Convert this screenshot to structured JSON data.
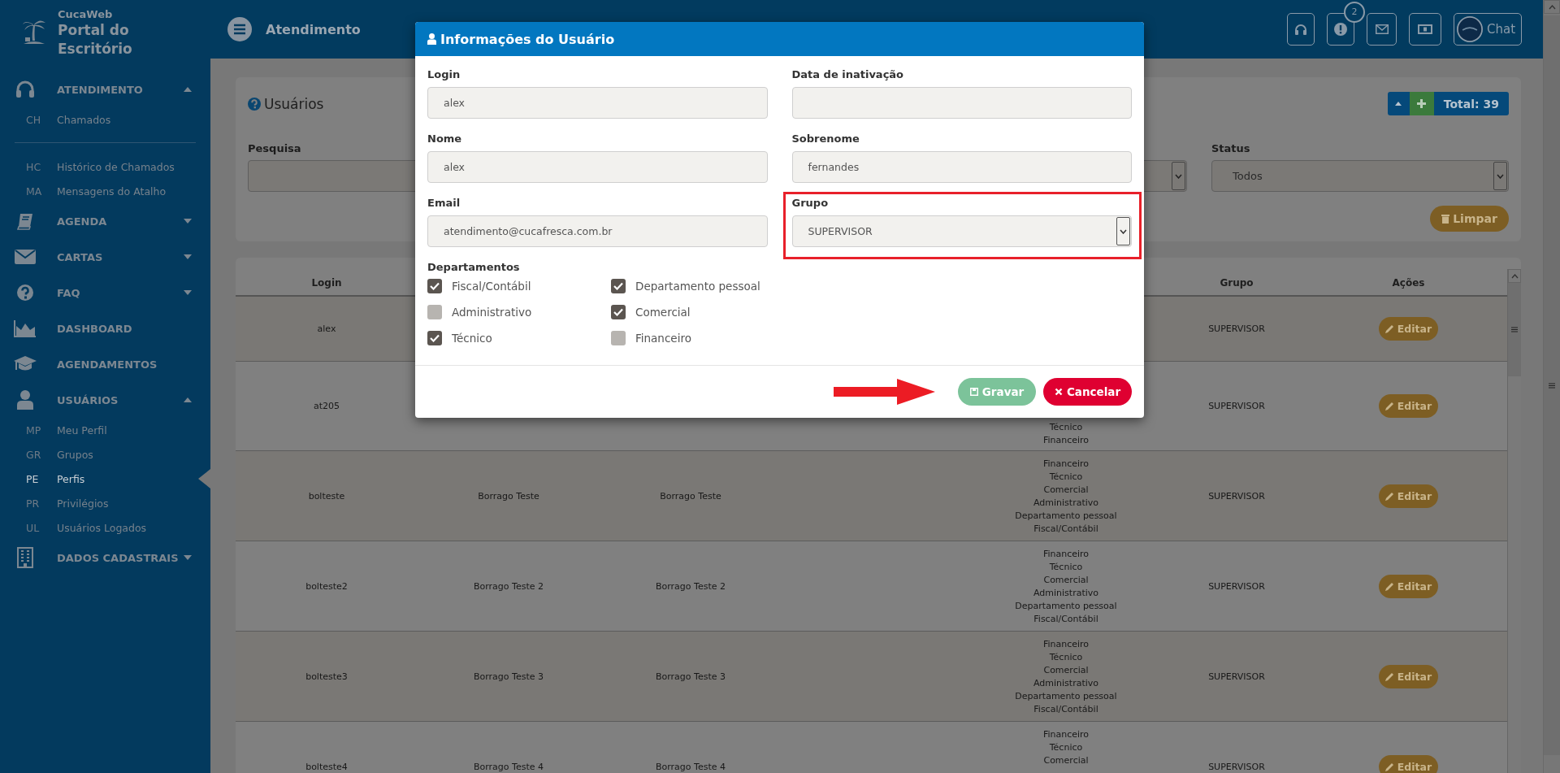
{
  "sidebar": {
    "app_name": "CucaWeb",
    "title": "Portal do Escritório",
    "sections": [
      {
        "label": "ATENDIMENTO",
        "kind": "group",
        "expanded": true,
        "children": [
          {
            "code": "CH",
            "label": "Chamados",
            "selected": false,
            "divider_above": false
          },
          {
            "code": "HC",
            "label": "Histórico de Chamados",
            "selected": false,
            "divider_above": true
          },
          {
            "code": "MA",
            "label": "Mensagens do Atalho",
            "selected": false,
            "divider_above": false
          }
        ]
      },
      {
        "label": "AGENDA",
        "kind": "group",
        "expanded": false
      },
      {
        "label": "CARTAS",
        "kind": "group",
        "expanded": false
      },
      {
        "label": "FAQ",
        "kind": "group",
        "expanded": false
      },
      {
        "label": "DASHBOARD",
        "kind": "link"
      },
      {
        "label": "AGENDAMENTOS",
        "kind": "link"
      },
      {
        "label": "USUÁRIOS",
        "kind": "group",
        "expanded": true,
        "children": [
          {
            "code": "MP",
            "label": "Meu Perfil",
            "selected": false,
            "divider_above": false
          },
          {
            "code": "GR",
            "label": "Grupos",
            "selected": false,
            "divider_above": false
          },
          {
            "code": "PE",
            "label": "Perfis",
            "selected": true,
            "divider_above": false
          },
          {
            "code": "PR",
            "label": "Privilégios",
            "selected": false,
            "divider_above": false
          },
          {
            "code": "UL",
            "label": "Usuários Logados",
            "selected": false,
            "divider_above": false
          }
        ]
      },
      {
        "label": "DADOS CADASTRAIS",
        "kind": "group",
        "expanded": false
      }
    ]
  },
  "header": {
    "title": "Atendimento",
    "notification_count": "2",
    "chat_label": "Chat"
  },
  "page": {
    "title": "Usuários",
    "total": "Total: 39",
    "filters": [
      {
        "label": "Pesquisa",
        "kind": "text"
      },
      {
        "kind": "select"
      },
      {
        "label": "Status",
        "kind": "select",
        "value": "Todos"
      }
    ],
    "clear_button": "Limpar"
  },
  "table": {
    "columns": [
      "Login",
      "Grupo",
      "Ações"
    ],
    "rows": [
      {
        "login": "alex",
        "grupo": "SUPERVISOR",
        "action": "Editar"
      },
      {
        "login": "at205",
        "departments": [
          "Técnico",
          "Financeiro"
        ],
        "grupo": "SUPERVISOR",
        "action": "Editar"
      },
      {
        "login": "bolteste",
        "column_2": "Borrago Teste",
        "column_3": "Borrago Teste",
        "departments": [
          "Financeiro",
          "Técnico",
          "Comercial",
          "Administrativo",
          "Departamento pessoal",
          "Fiscal/Contábil"
        ],
        "grupo": "SUPERVISOR",
        "action": "Editar"
      },
      {
        "login": "bolteste2",
        "column_2": "Borrago Teste 2",
        "column_3": "Borrago Teste 2",
        "departments": [
          "Financeiro",
          "Técnico",
          "Comercial",
          "Administrativo",
          "Departamento pessoal",
          "Fiscal/Contábil"
        ],
        "grupo": "SUPERVISOR",
        "action": "Editar"
      },
      {
        "login": "bolteste3",
        "column_2": "Borrago Teste 3",
        "column_3": "Borrago Teste 3",
        "departments": [
          "Financeiro",
          "Técnico",
          "Comercial",
          "Administrativo",
          "Departamento pessoal",
          "Fiscal/Contábil"
        ],
        "grupo": "SUPERVISOR",
        "action": "Editar"
      },
      {
        "login": "bolteste4",
        "column_2": "Borrago Teste 4",
        "column_3": "Borrago Teste 4",
        "departments": [
          "Financeiro",
          "Técnico",
          "Comercial"
        ],
        "grupo": "SUPERVISOR",
        "action": "Editar"
      }
    ]
  },
  "modal": {
    "title": "Informações do Usuário",
    "fields": [
      {
        "label": "Login",
        "value": "alex",
        "kind": "text",
        "highlighted": false
      },
      {
        "label": "Data de inativação",
        "kind": "text",
        "highlighted": false
      },
      {
        "label": "Nome",
        "value": "alex",
        "kind": "text",
        "highlighted": false
      },
      {
        "label": "Sobrenome",
        "value": "fernandes",
        "kind": "text",
        "highlighted": false
      },
      {
        "label": "Email",
        "value": "atendimento@cucafresca.com.br",
        "kind": "text",
        "highlighted": false
      },
      {
        "label": "Grupo",
        "value": "SUPERVISOR",
        "kind": "select",
        "highlighted": true
      }
    ],
    "departments_label": "Departamentos",
    "departments": [
      {
        "label": "Fiscal/Contábil",
        "checked": true
      },
      {
        "label": "Departamento pessoal",
        "checked": true
      },
      {
        "label": "Administrativo",
        "checked": false
      },
      {
        "label": "Comercial",
        "checked": true
      },
      {
        "label": "Técnico",
        "checked": true
      },
      {
        "label": "Financeiro",
        "checked": false
      }
    ],
    "buttons": [
      {
        "label": "Gravar",
        "kind": "save",
        "pointed_at": true
      },
      {
        "label": "Cancelar",
        "kind": "cancel",
        "pointed_at": false
      }
    ]
  }
}
